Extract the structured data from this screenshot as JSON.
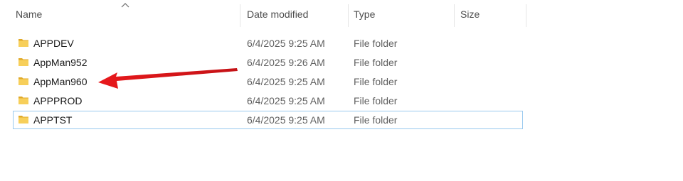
{
  "columns": {
    "name": "Name",
    "date_modified": "Date modified",
    "type": "Type",
    "size": "Size"
  },
  "sort": {
    "column": "name",
    "direction": "ascending",
    "icon": "caret-up-icon"
  },
  "rows": [
    {
      "name": "APPDEV",
      "date": "6/4/2025 9:25 AM",
      "type": "File folder",
      "size": "",
      "icon": "folder-icon"
    },
    {
      "name": "AppMan952",
      "date": "6/4/2025 9:26 AM",
      "type": "File folder",
      "size": "",
      "icon": "folder-icon"
    },
    {
      "name": "AppMan960",
      "date": "6/4/2025 9:25 AM",
      "type": "File folder",
      "size": "",
      "icon": "folder-icon"
    },
    {
      "name": "APPPROD",
      "date": "6/4/2025 9:25 AM",
      "type": "File folder",
      "size": "",
      "icon": "folder-icon"
    },
    {
      "name": "APPTST",
      "date": "6/4/2025 9:25 AM",
      "type": "File folder",
      "size": "",
      "icon": "folder-icon",
      "selected": true
    }
  ],
  "annotation": {
    "type": "arrow",
    "color": "#e8191c",
    "points_to": "AppMan960"
  },
  "colors": {
    "folder": "#f2c94c",
    "selection_border": "#99c9ef",
    "header_text": "#4c4c4c"
  }
}
